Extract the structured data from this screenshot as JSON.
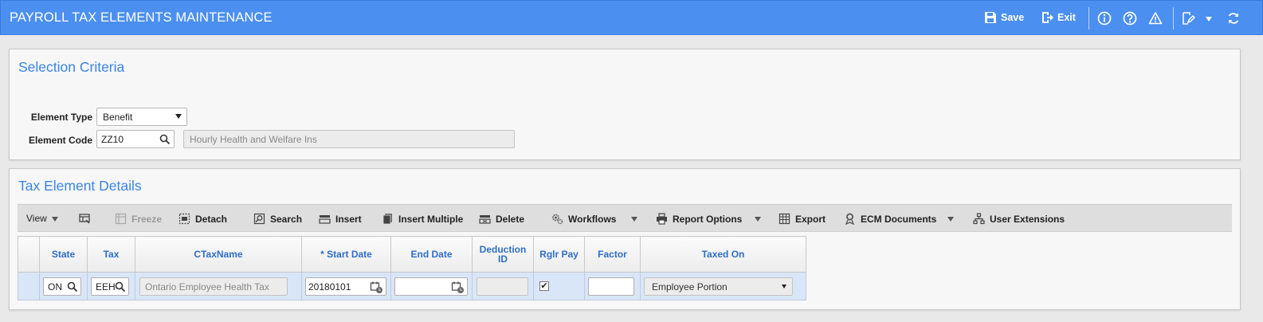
{
  "header": {
    "title": "PAYROLL TAX ELEMENTS MAINTENANCE",
    "save_label": "Save",
    "exit_label": "Exit",
    "icons": [
      "info-icon",
      "help-icon",
      "warning-icon",
      "edit-icon",
      "chevron-down-icon",
      "refresh-icon"
    ]
  },
  "selection": {
    "title": "Selection Criteria",
    "element_type_label": "Element Type",
    "element_type_value": "Benefit",
    "element_code_label": "Element Code",
    "element_code_value": "ZZ10",
    "element_desc_value": "Hourly Health and Welfare Ins"
  },
  "details": {
    "title": "Tax Element Details",
    "toolbar": {
      "view": "View",
      "freeze": "Freeze",
      "detach": "Detach",
      "search": "Search",
      "insert": "Insert",
      "insert_multiple": "Insert Multiple",
      "delete": "Delete",
      "workflows": "Workflows",
      "report_options": "Report Options",
      "export": "Export",
      "ecm_documents": "ECM Documents",
      "user_extensions": "User Extensions"
    },
    "columns": {
      "state": "State",
      "tax": "Tax",
      "ctaxname": "CTaxName",
      "start_date": "* Start Date",
      "end_date": "End Date",
      "deduction_id_1": "Deduction",
      "deduction_id_2": "ID",
      "rglr_pay": "Rglr Pay",
      "factor": "Factor",
      "taxed_on": "Taxed On"
    },
    "row": {
      "state": "ON",
      "tax": "EEH",
      "ctaxname": "Ontario Employee Health Tax",
      "start_date": "20180101",
      "end_date": "",
      "deduction_id": "",
      "rglr_pay_checked": true,
      "factor": "",
      "taxed_on": "Employee Portion"
    }
  },
  "colors": {
    "titlebar": "#4b8ff0",
    "panel_title": "#3a84e6",
    "column_header_text": "#2e6ec7",
    "selected_row": "#d9e6f8"
  }
}
